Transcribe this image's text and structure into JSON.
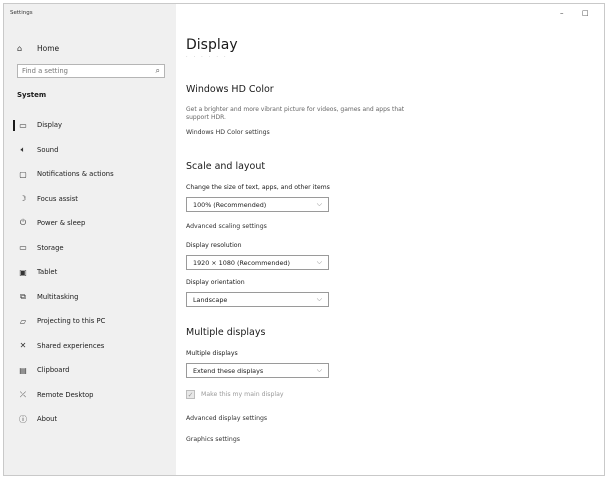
{
  "window": {
    "title": "Settings",
    "minimize_glyph": "–",
    "maximize_glyph": "□"
  },
  "sidebar": {
    "home": {
      "label": "Home",
      "icon": "home-icon",
      "glyph": "⌂"
    },
    "search": {
      "placeholder": "Find a setting",
      "icon": "search-icon",
      "glyph": "⌕"
    },
    "section": "System",
    "items": [
      {
        "label": "Display",
        "icon": "monitor-icon",
        "glyph": "▭",
        "active": true
      },
      {
        "label": "Sound",
        "icon": "speaker-icon",
        "glyph": "🔈︎"
      },
      {
        "label": "Notifications & actions",
        "icon": "notification-icon",
        "glyph": "▢"
      },
      {
        "label": "Focus assist",
        "icon": "moon-icon",
        "glyph": "☽"
      },
      {
        "label": "Power & sleep",
        "icon": "power-icon",
        "glyph": "⏻"
      },
      {
        "label": "Storage",
        "icon": "storage-icon",
        "glyph": "▭"
      },
      {
        "label": "Tablet",
        "icon": "tablet-icon",
        "glyph": "▣"
      },
      {
        "label": "Multitasking",
        "icon": "multitasking-icon",
        "glyph": "⧉"
      },
      {
        "label": "Projecting to this PC",
        "icon": "projector-icon",
        "glyph": "▱"
      },
      {
        "label": "Shared experiences",
        "icon": "shared-icon",
        "glyph": "✕"
      },
      {
        "label": "Clipboard",
        "icon": "clipboard-icon",
        "glyph": "▤"
      },
      {
        "label": "Remote Desktop",
        "icon": "remote-desktop-icon",
        "glyph": "⤫"
      },
      {
        "label": "About",
        "icon": "info-icon",
        "glyph": "ⓘ"
      }
    ]
  },
  "main": {
    "title": "Display",
    "hd_color": {
      "heading": "Windows HD Color",
      "description": "Get a brighter and more vibrant picture for videos, games and apps that support HDR.",
      "link": "Windows HD Color settings"
    },
    "scale": {
      "heading": "Scale and layout",
      "size_label": "Change the size of text, apps, and other items",
      "size_value": "100% (Recommended)",
      "advanced_link": "Advanced scaling settings",
      "resolution_label": "Display resolution",
      "resolution_value": "1920 × 1080 (Recommended)",
      "orientation_label": "Display orientation",
      "orientation_value": "Landscape"
    },
    "multiple": {
      "heading": "Multiple displays",
      "label": "Multiple displays",
      "value": "Extend these displays",
      "main_display_label": "Make this my main display",
      "main_display_checked": true,
      "advanced_link": "Advanced display settings",
      "graphics_link": "Graphics settings"
    }
  },
  "colors": {
    "sidebar_bg": "#f0f0f0",
    "accent": "#1a1a1a",
    "disabled": "#9a9a9a"
  }
}
